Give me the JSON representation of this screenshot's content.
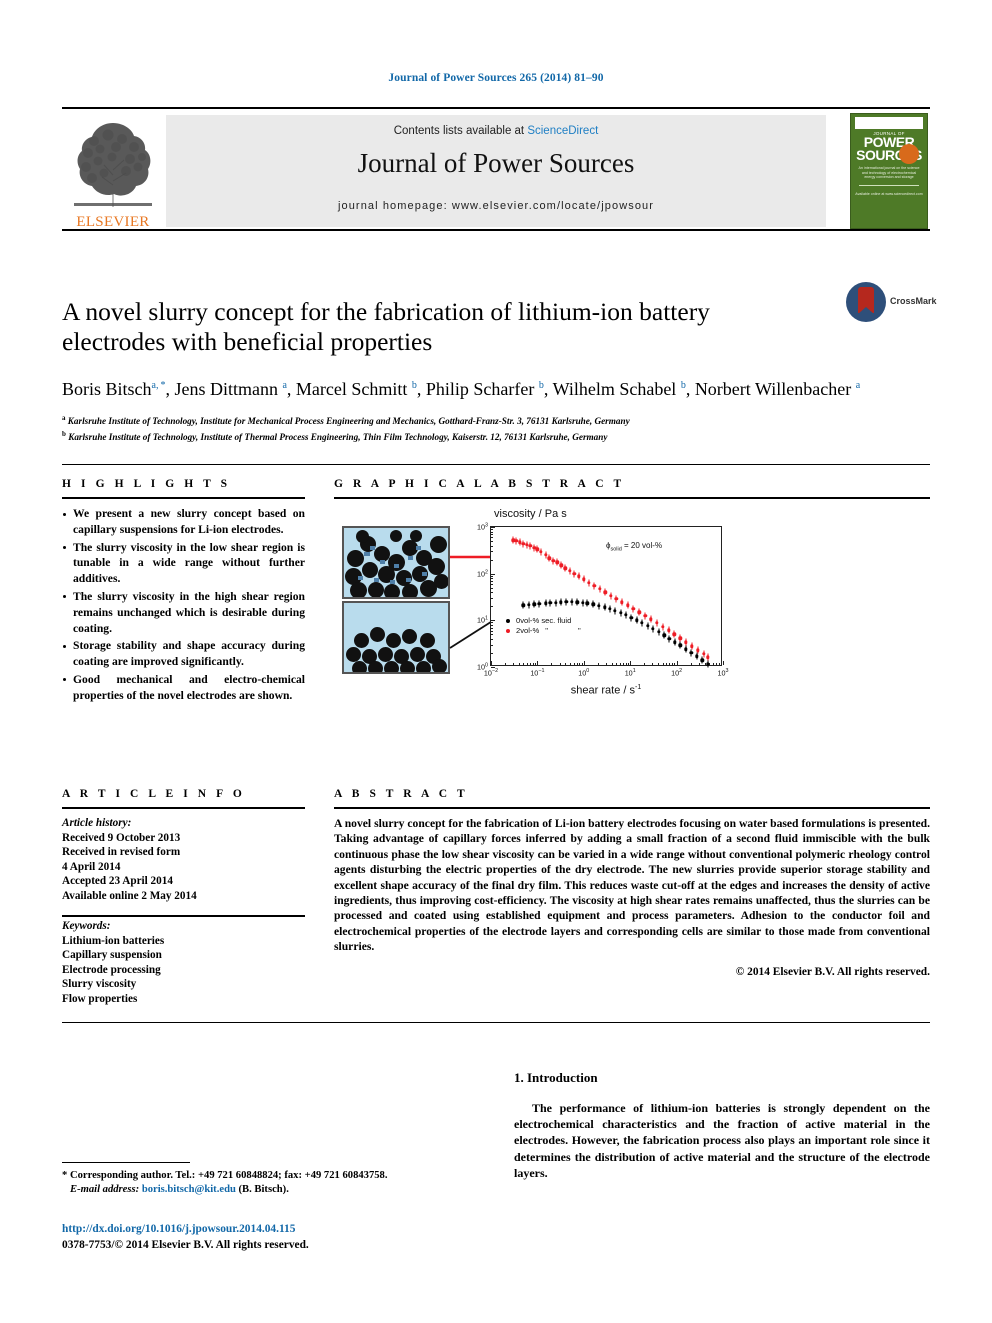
{
  "running_head": "Journal of Power Sources 265 (2014) 81–90",
  "masthead": {
    "contents_prefix": "Contents lists available at ",
    "sciencedirect": "ScienceDirect",
    "journal_title": "Journal of Power Sources",
    "homepage": "journal homepage: www.elsevier.com/locate/jpowsour",
    "publisher_logo_text": "ELSEVIER",
    "cover": {
      "journal_of": "JOURNAL OF",
      "line1": "POWER",
      "line2": "SOURCES",
      "blurb": "An international journal on the science and technology of electrochemical energy conversion and storage",
      "foot": "Available online at www.sciencedirect.com"
    }
  },
  "article": {
    "title": "A novel slurry concept for the fabrication of lithium-ion battery electrodes with beneficial properties",
    "authors_html": "Boris Bitsch<sup>a, *</sup>, Jens Dittmann <sup>a</sup>, Marcel Schmitt <sup>b</sup>, Philip Scharfer <sup>b</sup>, Wilhelm Schabel <sup>b</sup>, Norbert Willenbacher <sup>a</sup>",
    "affiliation_a": "Karlsruhe Institute of Technology, Institute for Mechanical Process Engineering and Mechanics, Gotthard-Franz-Str. 3, 76131 Karlsruhe, Germany",
    "affiliation_b": "Karlsruhe Institute of Technology, Institute of Thermal Process Engineering, Thin Film Technology, Kaiserstr. 12, 76131 Karlsruhe, Germany",
    "crossmark_label": "CrossMark"
  },
  "highlights": {
    "heading": "H I G H L I G H T S",
    "items": [
      "We present a new slurry concept based on capillary suspensions for Li-ion electrodes.",
      "The slurry viscosity in the low shear region is tunable in a wide range without further additives.",
      "The slurry viscosity in the high shear region remains unchanged which is desirable during coating.",
      "Storage stability and shape accuracy during coating are improved significantly.",
      "Good mechanical and electro-chemical properties of the novel electrodes are shown."
    ]
  },
  "graphical_abstract": {
    "heading": "G R A P H I C A L   A B S T R A C T"
  },
  "chart_data": {
    "type": "scatter",
    "title": "viscosity / Pa s",
    "xlabel": "shear rate / s",
    "xlabel_sup": "-1",
    "ylabel": "viscosity / Pa s",
    "xscale": "log",
    "yscale": "log",
    "xlim": [
      0.01,
      1000
    ],
    "ylim": [
      1,
      1000
    ],
    "xticks": [
      "10-2",
      "10-1",
      "100",
      "101",
      "102",
      "103"
    ],
    "yticks": [
      "100",
      "101",
      "102",
      "103"
    ],
    "grid": false,
    "annotation": "ϕsolid = 20 vol-%",
    "annotation_symbol": "ϕ",
    "annotation_sub": "solid",
    "annotation_value": "= 20 vol-%",
    "legend_position": "lower-left-inside",
    "series": [
      {
        "name": "0vol-% sec. fluid",
        "color": "#000000",
        "x": [
          0.05,
          0.065,
          0.085,
          0.11,
          0.15,
          0.19,
          0.25,
          0.32,
          0.42,
          0.55,
          0.72,
          0.95,
          1.2,
          1.6,
          2.1,
          2.8,
          3.6,
          4.7,
          6.2,
          8.1,
          10.6,
          14,
          18,
          24,
          31,
          41,
          54,
          70,
          92,
          120,
          158,
          207,
          272,
          357,
          468
        ],
        "y": [
          21,
          21.5,
          22,
          22.5,
          23,
          23.5,
          24,
          24.5,
          25,
          25,
          24.5,
          24,
          23,
          22,
          20.5,
          19,
          17.5,
          16,
          14.5,
          13,
          11.5,
          10,
          8.8,
          7.6,
          6.5,
          5.6,
          4.8,
          4.0,
          3.4,
          2.9,
          2.4,
          2.0,
          1.7,
          1.4,
          1.15
        ]
      },
      {
        "name": "2vol-%",
        "color": "#ee1c25",
        "x": [
          0.03,
          0.035,
          0.042,
          0.05,
          0.06,
          0.07,
          0.085,
          0.1,
          0.12,
          0.15,
          0.18,
          0.22,
          0.27,
          0.33,
          0.4,
          0.5,
          0.62,
          0.78,
          1.0,
          1.3,
          1.7,
          2.2,
          2.9,
          3.8,
          5.0,
          6.6,
          8.8,
          11.7,
          15.6,
          21,
          28,
          37,
          50,
          67,
          90,
          120,
          160,
          215,
          290,
          390,
          470
        ],
        "y": [
          520,
          500,
          470,
          440,
          420,
          390,
          360,
          330,
          290,
          250,
          215,
          190,
          175,
          150,
          130,
          115,
          100,
          88,
          75,
          64,
          55,
          47,
          40,
          34,
          29,
          24.5,
          21,
          17.5,
          15,
          12.5,
          10.5,
          8.8,
          7.3,
          6.1,
          5.0,
          4.1,
          3.4,
          2.8,
          2.3,
          1.9,
          1.6
        ]
      }
    ]
  },
  "article_info": {
    "heading": "A R T I C L E   I N F O",
    "history_label": "Article history:",
    "history": [
      "Received 9 October 2013",
      "Received in revised form",
      "4 April 2014",
      "Accepted 23 April 2014",
      "Available online 2 May 2014"
    ],
    "keywords_label": "Keywords:",
    "keywords": [
      "Lithium-ion batteries",
      "Capillary suspension",
      "Electrode processing",
      "Slurry viscosity",
      "Flow properties"
    ]
  },
  "abstract": {
    "heading": "A B S T R A C T",
    "text": "A novel slurry concept for the fabrication of Li-ion battery electrodes focusing on water based formulations is presented. Taking advantage of capillary forces inferred by adding a small fraction of a second fluid immiscible with the bulk continuous phase the low shear viscosity can be varied in a wide range without conventional polymeric rheology control agents disturbing the electric properties of the dry electrode. The new slurries provide superior storage stability and excellent shape accuracy of the final dry film. This reduces waste cut-off at the edges and increases the density of active ingredients, thus improving cost-efficiency. The viscosity at high shear rates remains unaffected, thus the slurries can be processed and coated using established equipment and process parameters. Adhesion to the conductor foil and electrochemical properties of the electrode layers and corresponding cells are similar to those made from conventional slurries.",
    "copyright": "© 2014 Elsevier B.V. All rights reserved."
  },
  "introduction": {
    "heading": "1.  Introduction",
    "paragraph": "The performance of lithium-ion batteries is strongly dependent on the electrochemical characteristics and the fraction of active material in the electrodes. However, the fabrication process also plays an important role since it determines the distribution of active material and the structure of the electrode layers."
  },
  "footer": {
    "corresponding": "* Corresponding author. Tel.: +49 721 60848824; fax: +49 721 60843758.",
    "email_label": "E-mail address:",
    "email": "boris.bitsch@kit.edu",
    "email_suffix": "(B. Bitsch).",
    "doi": "http://dx.doi.org/10.1016/j.jpowsour.2014.04.115",
    "issn": "0378-7753/© 2014 Elsevier B.V. All rights reserved."
  }
}
